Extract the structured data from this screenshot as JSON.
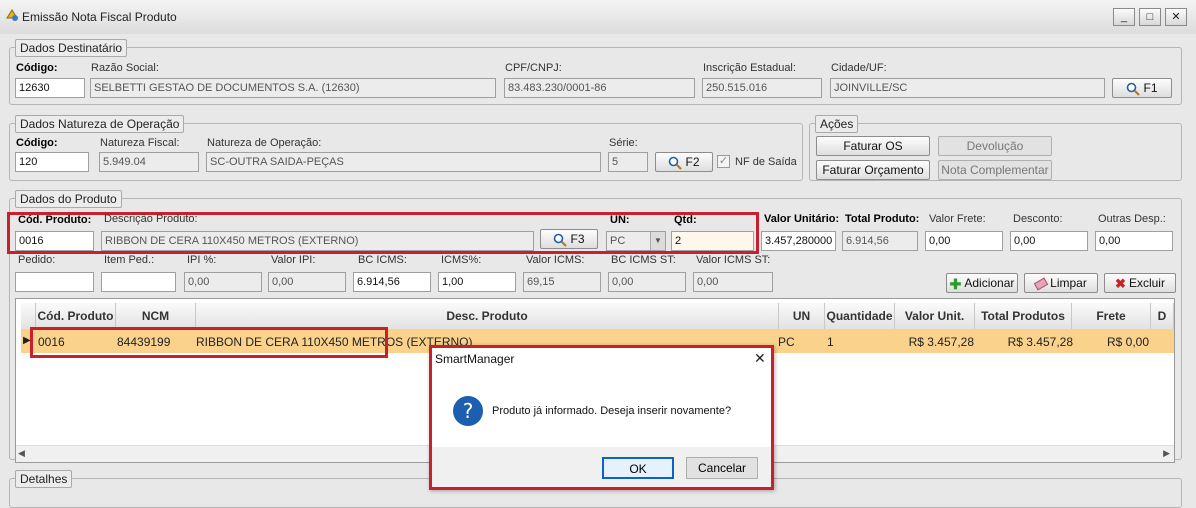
{
  "window": {
    "title": "Emissão Nota Fiscal Produto",
    "minimize": "_",
    "maximize": "□",
    "close": "✕"
  },
  "destinatario": {
    "legend": "Dados Destinatário",
    "codigo_label": "Código:",
    "codigo": "12630",
    "razao_label": "Razão Social:",
    "razao": "SELBETTI GESTAO DE DOCUMENTOS S.A. (12630)",
    "cpf_label": "CPF/CNPJ:",
    "cpf": "83.483.230/0001-86",
    "ie_label": "Inscrição Estadual:",
    "ie": "250.515.016",
    "cidade_label": "Cidade/UF:",
    "cidade": "JOINVILLE/SC",
    "f1": "F1"
  },
  "natureza": {
    "legend": "Dados Natureza de Operação",
    "codigo_label": "Código:",
    "codigo": "120",
    "nf_label": "Natureza Fiscal:",
    "nf": "5.949.04",
    "nat_label": "Natureza de Operação:",
    "nat": "SC-OUTRA SAIDA-PEÇAS",
    "serie_label": "Série:",
    "serie": "5",
    "f2": "F2",
    "nf_saida": "NF de Saída"
  },
  "acoes": {
    "legend": "Ações",
    "faturar_os": "Faturar OS",
    "devolucao": "Devolução",
    "faturar_orc": "Faturar Orçamento",
    "nota_comp": "Nota Complementar"
  },
  "produto": {
    "legend": "Dados do Produto",
    "cod_label": "Cód. Produto:",
    "cod": "0016",
    "desc_label": "Descrição Produto:",
    "desc": "RIBBON DE CERA 110X450 METROS (EXTERNO)",
    "f3": "F3",
    "un_label": "UN:",
    "un": "PC",
    "qtd_label": "Qtd:",
    "qtd": "2",
    "vu_label": "Valor Unitário:",
    "vu": "3.457,280000",
    "tp_label": "Total Produto:",
    "tp": "6.914,56",
    "vf_label": "Valor Frete:",
    "vf": "0,00",
    "desc2_label": "Desconto:",
    "desc2": "0,00",
    "od_label": "Outras Desp.:",
    "od": "0,00",
    "pedido_label": "Pedido:",
    "pedido": "",
    "item_label": "Item Ped.:",
    "item": "",
    "ipi_label": "IPI %:",
    "ipi": "0,00",
    "vipi_label": "Valor IPI:",
    "vipi": "0,00",
    "bcicms_label": "BC ICMS:",
    "bcicms": "6.914,56",
    "icms_label": "ICMS%:",
    "icms": "1,00",
    "vicms_label": "Valor ICMS:",
    "vicms": "69,15",
    "bcst_label": "BC ICMS ST:",
    "bcst": "0,00",
    "vst_label": "Valor ICMS ST:",
    "vst": "0,00",
    "adicionar": "Adicionar",
    "limpar": "Limpar",
    "excluir": "Excluir"
  },
  "grid": {
    "headers": [
      "Cód. Produto",
      "NCM",
      "Desc. Produto",
      "UN",
      "Quantidade",
      "Valor Unit.",
      "Total Produtos",
      "Frete",
      "D"
    ],
    "row": [
      "0016",
      "84439199",
      "RIBBON DE CERA 110X450 METROS (EXTERNO)",
      "PC",
      "1",
      "R$ 3.457,28",
      "R$ 3.457,28",
      "R$ 0,00"
    ]
  },
  "detalhes": {
    "legend": "Detalhes"
  },
  "dialog": {
    "title": "SmartManager",
    "message": "Produto já informado. Deseja inserir novamente?",
    "ok": "OK",
    "cancel": "Cancelar",
    "icon": "question-icon"
  },
  "colors": {
    "highlight": "#c8202c",
    "row_selected": "#fbd28b",
    "info_blue": "#1c5fb0"
  }
}
